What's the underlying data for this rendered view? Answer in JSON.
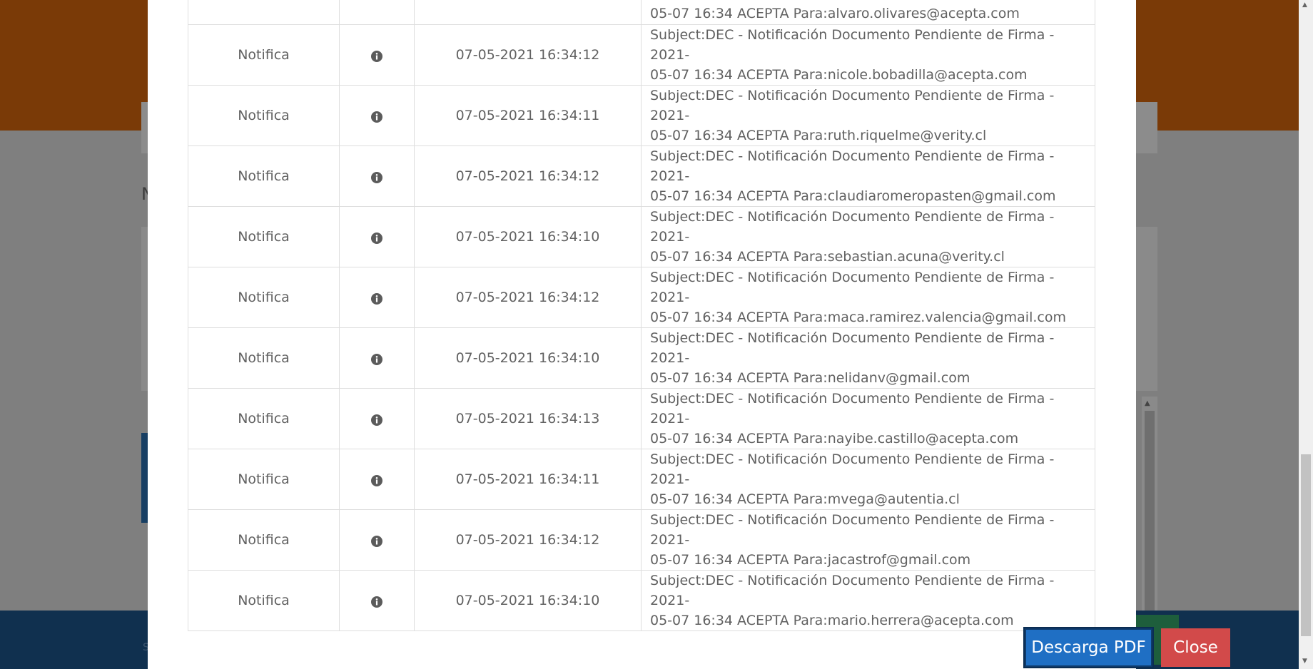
{
  "background": {
    "letter": "N",
    "footer_text": "S"
  },
  "log_rows": [
    {
      "type": "",
      "date": "",
      "detail": "05-07 16:34 ACEPTA Para:alvaro.olivares@acepta.com",
      "partial": true
    },
    {
      "type": "Notifica",
      "date": "07-05-2021 16:34:12",
      "detail_line1": "Subject:DEC - Notificación Documento Pendiente de Firma - 2021-",
      "detail_line2": "05-07 16:34 ACEPTA Para:nicole.bobadilla@acepta.com"
    },
    {
      "type": "Notifica",
      "date": "07-05-2021 16:34:11",
      "detail_line1": "Subject:DEC - Notificación Documento Pendiente de Firma - 2021-",
      "detail_line2": "05-07 16:34 ACEPTA Para:ruth.riquelme@verity.cl"
    },
    {
      "type": "Notifica",
      "date": "07-05-2021 16:34:12",
      "detail_line1": "Subject:DEC - Notificación Documento Pendiente de Firma - 2021-",
      "detail_line2": "05-07 16:34 ACEPTA Para:claudiaromeropasten@gmail.com"
    },
    {
      "type": "Notifica",
      "date": "07-05-2021 16:34:10",
      "detail_line1": "Subject:DEC - Notificación Documento Pendiente de Firma - 2021-",
      "detail_line2": "05-07 16:34 ACEPTA Para:sebastian.acuna@verity.cl"
    },
    {
      "type": "Notifica",
      "date": "07-05-2021 16:34:12",
      "detail_line1": "Subject:DEC - Notificación Documento Pendiente de Firma - 2021-",
      "detail_line2": "05-07 16:34 ACEPTA Para:maca.ramirez.valencia@gmail.com"
    },
    {
      "type": "Notifica",
      "date": "07-05-2021 16:34:10",
      "detail_line1": "Subject:DEC - Notificación Documento Pendiente de Firma - 2021-",
      "detail_line2": "05-07 16:34 ACEPTA Para:nelidanv@gmail.com"
    },
    {
      "type": "Notifica",
      "date": "07-05-2021 16:34:13",
      "detail_line1": "Subject:DEC - Notificación Documento Pendiente de Firma - 2021-",
      "detail_line2": "05-07 16:34 ACEPTA Para:nayibe.castillo@acepta.com"
    },
    {
      "type": "Notifica",
      "date": "07-05-2021 16:34:11",
      "detail_line1": "Subject:DEC - Notificación Documento Pendiente de Firma - 2021-",
      "detail_line2": "05-07 16:34 ACEPTA Para:mvega@autentia.cl"
    },
    {
      "type": "Notifica",
      "date": "07-05-2021 16:34:12",
      "detail_line1": "Subject:DEC - Notificación Documento Pendiente de Firma - 2021-",
      "detail_line2": "05-07 16:34 ACEPTA Para:jacastrof@gmail.com"
    },
    {
      "type": "Notifica",
      "date": "07-05-2021 16:34:10",
      "detail_line1": "Subject:DEC - Notificación Documento Pendiente de Firma - 2021-",
      "detail_line2": "05-07 16:34 ACEPTA Para:mario.herrera@acepta.com"
    }
  ],
  "row_icon": "info-circle-icon",
  "buttons": {
    "download_pdf": "Descarga PDF",
    "close": "Close"
  },
  "colors": {
    "header_orange": "#c25b0c",
    "pdf_button": "#1f6fc4",
    "close_button": "#d24a4a",
    "footer_blue": "#1a4f82"
  }
}
